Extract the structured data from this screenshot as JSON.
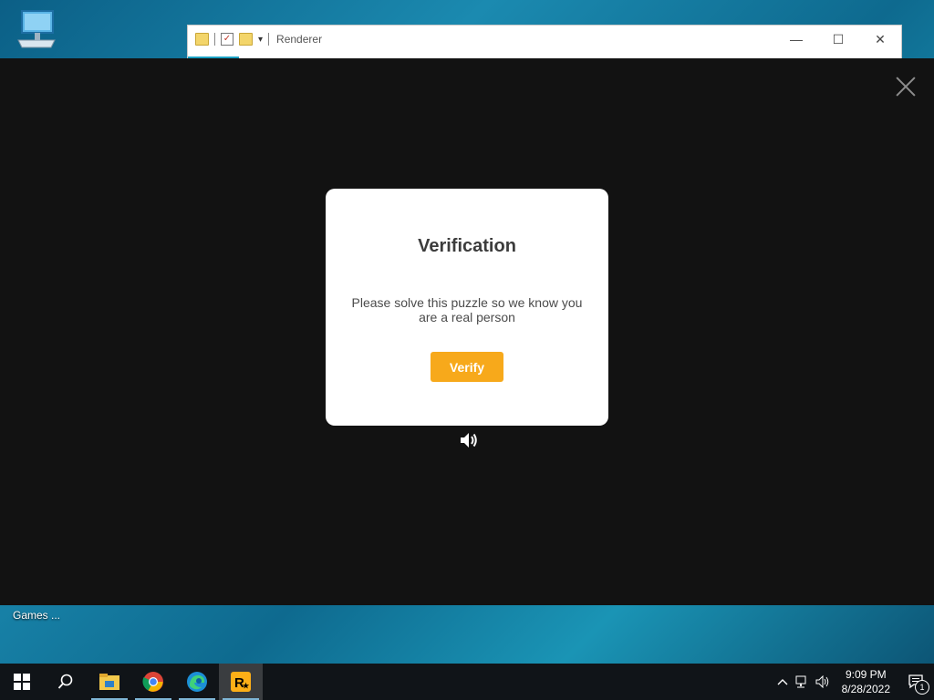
{
  "desktop": {
    "icons": [
      {
        "label": "My Computer"
      }
    ],
    "labels": {
      "games": "Games ..."
    }
  },
  "explorer": {
    "title": "Renderer",
    "controls": {
      "minimize": "—",
      "maximize": "☐",
      "close": "✕"
    }
  },
  "overlay": {
    "modal": {
      "title": "Verification",
      "message": "Please solve this puzzle so we know you are a real person",
      "button": "Verify"
    }
  },
  "taskbar": {
    "apps": [
      "start",
      "search",
      "file-explorer",
      "chrome",
      "edge",
      "rockstar-launcher"
    ],
    "clock": {
      "time": "9:09 PM",
      "date": "8/28/2022"
    },
    "notification_count": "1"
  },
  "colors": {
    "verify": "#f7a91b",
    "overlay": "#121212",
    "taskbar": "#101418"
  }
}
